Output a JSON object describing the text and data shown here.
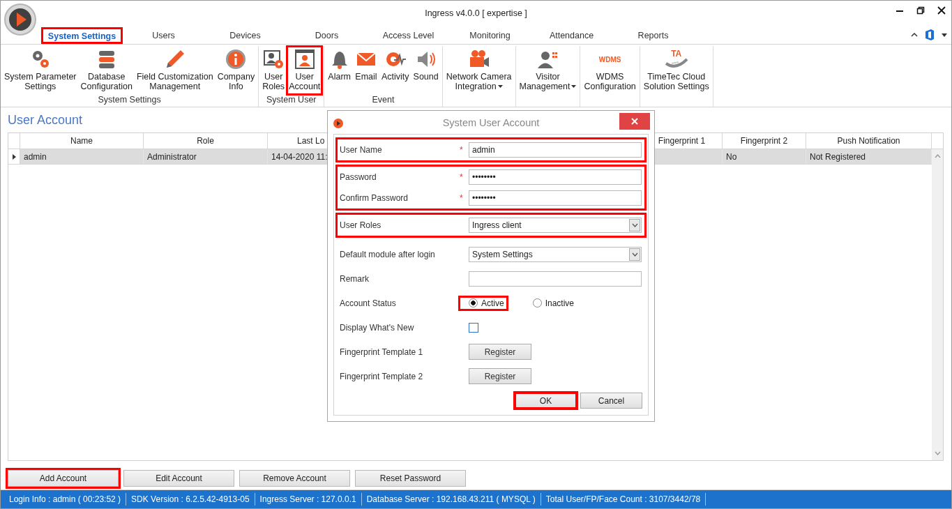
{
  "window": {
    "title": "Ingress v4.0.0 [ expertise ]"
  },
  "tabs": [
    {
      "label": "System Settings",
      "selected": true,
      "highlighted": true
    },
    {
      "label": "Users",
      "selected": false,
      "highlighted": false
    },
    {
      "label": "Devices",
      "selected": false,
      "highlighted": false
    },
    {
      "label": "Doors",
      "selected": false,
      "highlighted": false
    },
    {
      "label": "Access Level",
      "selected": false,
      "highlighted": false
    },
    {
      "label": "Monitoring",
      "selected": false,
      "highlighted": false
    },
    {
      "label": "Attendance",
      "selected": false,
      "highlighted": false
    },
    {
      "label": "Reports",
      "selected": false,
      "highlighted": false
    }
  ],
  "ribbon": {
    "groups": [
      {
        "label": "System Settings",
        "items": [
          {
            "lines": [
              "System Parameter",
              "Settings"
            ],
            "highlighted": false,
            "has_menu": false
          },
          {
            "lines": [
              "Database",
              "Configuration"
            ],
            "highlighted": false,
            "has_menu": false
          },
          {
            "lines": [
              "Field Customization",
              "Management"
            ],
            "highlighted": false,
            "has_menu": false
          },
          {
            "lines": [
              "Company",
              "Info"
            ],
            "highlighted": false,
            "has_menu": false
          }
        ]
      },
      {
        "label": "System User",
        "items": [
          {
            "lines": [
              "User",
              "Roles"
            ],
            "highlighted": false,
            "has_menu": false
          },
          {
            "lines": [
              "User",
              "Account"
            ],
            "highlighted": true,
            "has_menu": false
          }
        ]
      },
      {
        "label": "Event",
        "items": [
          {
            "lines": [
              "Alarm"
            ],
            "highlighted": false,
            "has_menu": false
          },
          {
            "lines": [
              "Email"
            ],
            "highlighted": false,
            "has_menu": false
          },
          {
            "lines": [
              "Activity"
            ],
            "highlighted": false,
            "has_menu": false
          },
          {
            "lines": [
              "Sound"
            ],
            "highlighted": false,
            "has_menu": false
          }
        ]
      },
      {
        "items": [
          {
            "lines": [
              "Network Camera",
              "Integration"
            ],
            "highlighted": false,
            "has_menu": true
          }
        ]
      },
      {
        "items": [
          {
            "lines": [
              "Visitor",
              "Management"
            ],
            "highlighted": false,
            "has_menu": true
          }
        ]
      },
      {
        "items": [
          {
            "lines": [
              "WDMS",
              "Configuration"
            ],
            "badge": "WDMS",
            "highlighted": false,
            "has_menu": false
          }
        ]
      },
      {
        "items": [
          {
            "lines": [
              "TimeTec Cloud",
              "Solution Settings"
            ],
            "badge": "TA",
            "highlighted": false,
            "has_menu": false
          }
        ]
      }
    ]
  },
  "page_title": "User Account",
  "table": {
    "columns": [
      "Name",
      "Role",
      "Last Lo",
      "Fingerprint 1",
      "Fingerprint 2",
      "Push Notification"
    ],
    "rows": [
      {
        "current": true,
        "cells": [
          "admin",
          "Administrator",
          "14-04-2020 11:",
          null,
          "No",
          "Not Registered"
        ]
      }
    ]
  },
  "buttons": [
    {
      "label": "Add Account",
      "highlighted": true
    },
    {
      "label": "Edit Account",
      "highlighted": false
    },
    {
      "label": "Remove Account",
      "highlighted": false
    },
    {
      "label": "Reset Password",
      "highlighted": false
    }
  ],
  "dialog": {
    "title": "System User Account",
    "groups": [
      {
        "highlighted": true,
        "fields": [
          {
            "kind": "text",
            "label": "User Name",
            "required_mark": "*",
            "value": "admin"
          }
        ]
      },
      {
        "highlighted": true,
        "fields": [
          {
            "kind": "text",
            "label": "Password",
            "required_mark": "*",
            "value": "••••••••"
          },
          {
            "kind": "text",
            "label": "Confirm Password",
            "required_mark": "*",
            "value": "••••••••"
          }
        ]
      },
      {
        "highlighted": true,
        "fields": [
          {
            "kind": "select",
            "label": "User Roles",
            "value": "Ingress client"
          }
        ]
      },
      {
        "highlighted": false,
        "fields": [
          {
            "kind": "select",
            "label": "Default module after login",
            "value": "System Settings"
          },
          {
            "kind": "text",
            "label": "Remark"
          },
          {
            "kind": "radio",
            "label": "Account Status",
            "options": [
              {
                "label": "Active",
                "selected": true,
                "highlighted": true
              },
              {
                "label": "Inactive",
                "selected": false,
                "highlighted": false
              }
            ]
          },
          {
            "kind": "checkbox",
            "label": "Display What's New",
            "checked": false
          },
          {
            "kind": "button",
            "label": "Fingerprint Template 1",
            "button_label": "Register"
          },
          {
            "kind": "button",
            "label": "Fingerprint Template 2",
            "button_label": "Register"
          }
        ]
      }
    ],
    "buttons": [
      {
        "label": "OK",
        "highlighted": true
      },
      {
        "label": "Cancel",
        "highlighted": false
      }
    ]
  },
  "status_bar": [
    "Login Info : admin ( 00:23:52 )",
    "SDK Version : 6.2.5.42-4913-05",
    "Ingress Server : 127.0.0.1",
    "Database Server : 192.168.43.211 ( MYSQL )",
    "Total User/FP/Face Count : 3107/3442/78"
  ]
}
